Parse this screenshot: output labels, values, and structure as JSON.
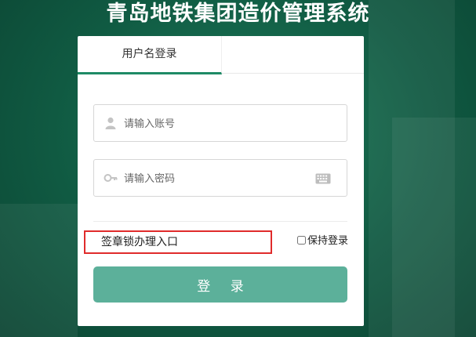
{
  "app": {
    "title": "青岛地铁集团造价管理系统"
  },
  "tabs": [
    {
      "label": "用户名登录"
    }
  ],
  "form": {
    "account_placeholder": "请输入账号",
    "password_placeholder": "请输入密码",
    "seal_link": "签章锁办理入口",
    "remember_label": "保持登录",
    "login_button": "登 录"
  },
  "icons": {
    "account": "user-icon",
    "password": "key-icon",
    "keyboard": "keyboard-icon"
  },
  "colors": {
    "accent": "#1e8a66",
    "button": "#5cb09a",
    "highlight_border": "#e02b2b",
    "background": "#105a42"
  }
}
